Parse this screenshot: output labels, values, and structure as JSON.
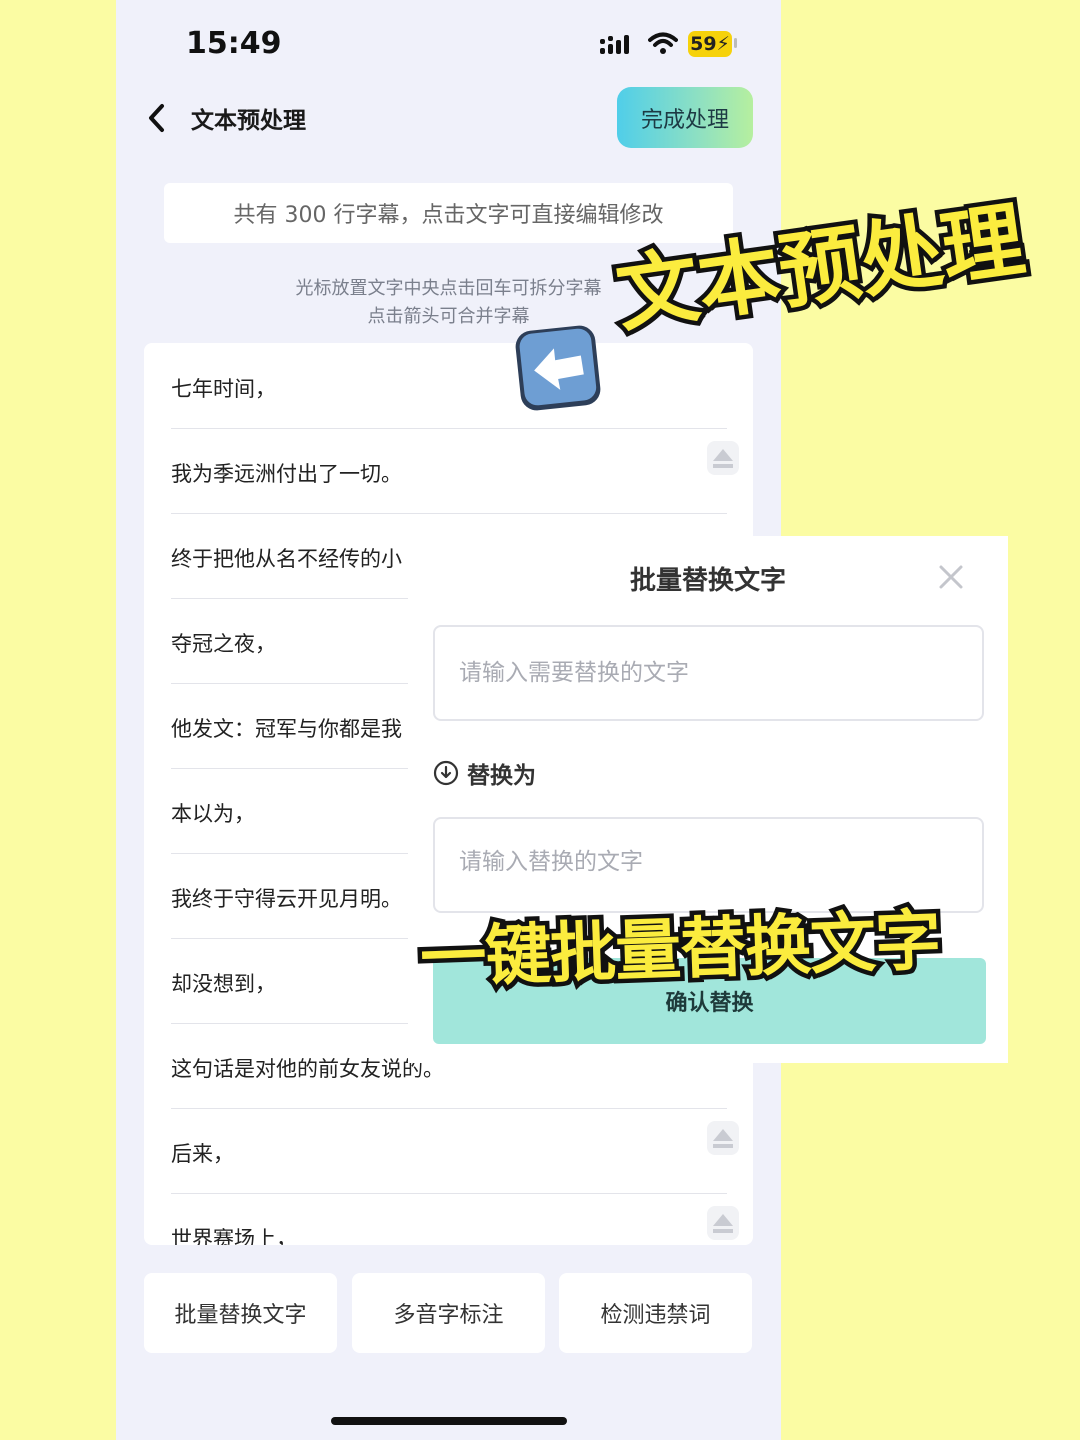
{
  "status_bar": {
    "time": "15:49",
    "battery": "59"
  },
  "header": {
    "title": "文本预处理",
    "done_label": "完成处理"
  },
  "info_banner": "共有 300 行字幕，点击文字可直接编辑修改",
  "hints": {
    "line1": "光标放置文字中央点击回车可拆分字幕",
    "line2": "点击箭头可合并字幕"
  },
  "subtitles": [
    "七年时间，",
    "我为季远洲付出了一切。",
    "终于把他从名不经传的小",
    "夺冠之夜，",
    "他发文：冠军与你都是我",
    "本以为，",
    "我终于守得云开见月明。",
    "却没想到，",
    "这句话是对他的前女友说的。",
    "后来，",
    "世界赛场上，"
  ],
  "bottom_actions": {
    "batch_replace": "批量替换文字",
    "polyphone": "多音字标注",
    "banned_words": "检测违禁词"
  },
  "dialog": {
    "title": "批量替换文字",
    "find_placeholder": "请输入需要替换的文字",
    "replace_with_label": "替换为",
    "replace_placeholder": "请输入替换的文字",
    "confirm_label": "确认替换"
  },
  "overlay": {
    "title": "文本预处理",
    "caption": "一键批量替换文字"
  },
  "colors": {
    "background": "#fbfca3",
    "accent_gradient_start": "#50cee9",
    "accent_gradient_end": "#b6ef9f",
    "confirm": "#a1e6db",
    "overlay_text": "#fbec3e"
  }
}
